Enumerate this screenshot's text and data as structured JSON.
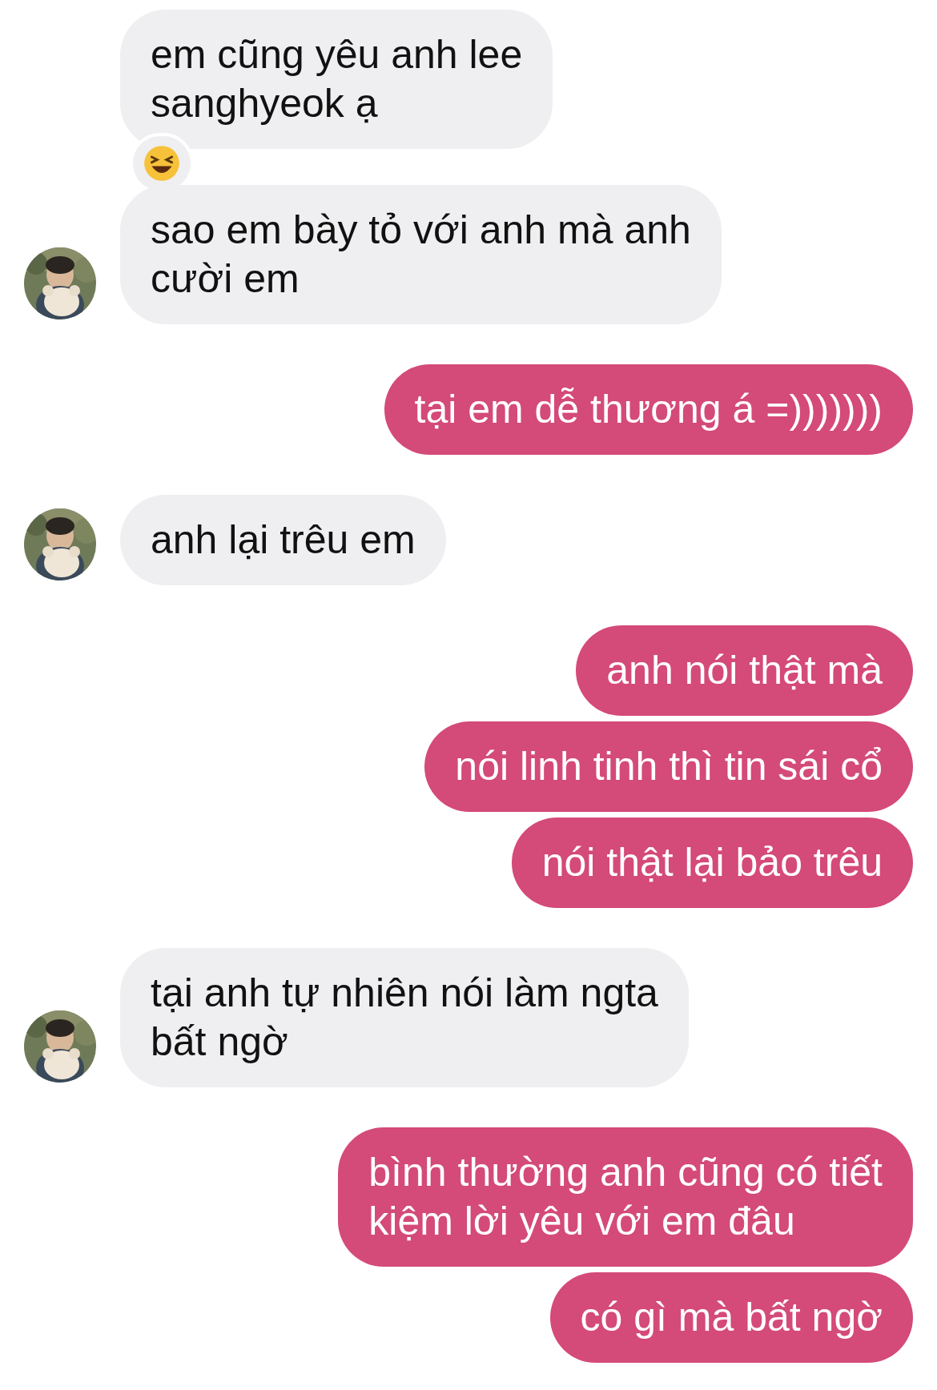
{
  "messages": [
    {
      "kind": "received",
      "text": "em cũng yêu anh lee\nsanghyeok ạ",
      "avatar": false,
      "reaction": true
    },
    {
      "kind": "received",
      "text": "sao em bày tỏ với anh mà anh\ncười em",
      "avatar": true,
      "reaction": false
    },
    {
      "kind": "sent",
      "text": "tại em dễ thương á =)))))))",
      "avatar": false,
      "reaction": false
    },
    {
      "kind": "received",
      "text": "anh lại trêu em",
      "avatar": true,
      "reaction": false
    },
    {
      "kind": "sent",
      "text": "anh nói thật mà",
      "avatar": false,
      "reaction": false
    },
    {
      "kind": "sent",
      "text": "nói linh tinh thì tin sái cổ",
      "avatar": false,
      "reaction": false
    },
    {
      "kind": "sent",
      "text": "nói thật lại bảo trêu",
      "avatar": false,
      "reaction": false
    },
    {
      "kind": "received",
      "text": "tại anh tự nhiên nói làm ngta\nbất ngờ",
      "avatar": true,
      "reaction": false
    },
    {
      "kind": "sent",
      "text": "bình thường anh cũng có tiết\nkiệm lời yêu với em đâu",
      "avatar": false,
      "reaction": false
    },
    {
      "kind": "sent",
      "text": "có gì mà bất ngờ",
      "avatar": false,
      "reaction": false
    }
  ]
}
